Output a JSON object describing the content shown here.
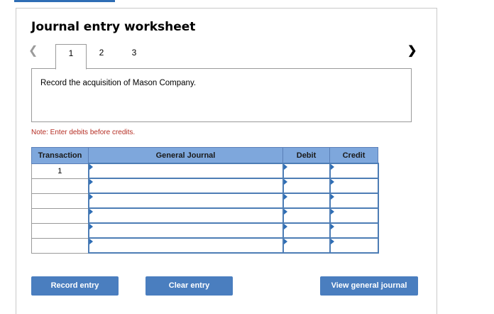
{
  "worksheet": {
    "title": "Journal entry worksheet",
    "tabs": [
      "1",
      "2",
      "3"
    ],
    "active_tab": "1",
    "description": "Record the acquisition of Mason Company.",
    "note": "Note: Enter debits before credits."
  },
  "table": {
    "headers": {
      "transaction": "Transaction",
      "general_journal": "General Journal",
      "debit": "Debit",
      "credit": "Credit"
    },
    "rows": [
      {
        "transaction": "1",
        "general_journal": "",
        "debit": "",
        "credit": ""
      },
      {
        "transaction": "",
        "general_journal": "",
        "debit": "",
        "credit": ""
      },
      {
        "transaction": "",
        "general_journal": "",
        "debit": "",
        "credit": ""
      },
      {
        "transaction": "",
        "general_journal": "",
        "debit": "",
        "credit": ""
      },
      {
        "transaction": "",
        "general_journal": "",
        "debit": "",
        "credit": ""
      },
      {
        "transaction": "",
        "general_journal": "",
        "debit": "",
        "credit": ""
      }
    ]
  },
  "buttons": {
    "record": "Record entry",
    "clear": "Clear entry",
    "view": "View general journal"
  },
  "colors": {
    "header_bg": "#7ea7dc",
    "button_bg": "#4a7ebf",
    "note_text": "#b52e24"
  },
  "icons": {
    "prev": "chevron-left-icon",
    "next": "chevron-right-icon"
  }
}
